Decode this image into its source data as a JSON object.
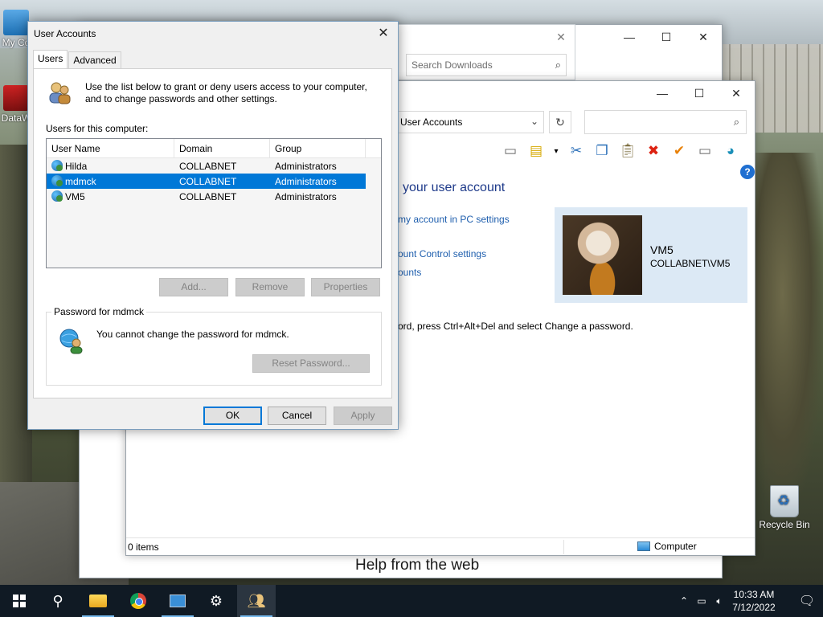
{
  "desktop": {
    "icons": [
      {
        "label": "My Co"
      },
      {
        "label": "DataW"
      }
    ],
    "recycle_bin": "Recycle Bin"
  },
  "help_window": {
    "help_from_web": "Help from the web"
  },
  "downloads_window": {
    "search_placeholder": "Search Downloads"
  },
  "control_panel": {
    "address": "User Accounts",
    "heading": "your user account",
    "links": [
      "my account in PC settings",
      "ount Control settings",
      "ounts"
    ],
    "user_name": "VM5",
    "user_domain": "COLLABNET\\VM5",
    "password_text": "ord, press Ctrl+Alt+Del and select Change a password.",
    "status_items": "0 items",
    "status_computer": "Computer"
  },
  "dialog": {
    "title": "User Accounts",
    "tabs": [
      "Users",
      "Advanced"
    ],
    "intro": "Use the list below to grant or deny users access to your computer, and to change passwords and other settings.",
    "users_label": "Users for this computer:",
    "columns": [
      "User Name",
      "Domain",
      "Group"
    ],
    "rows": [
      {
        "name": "Hilda",
        "domain": "COLLABNET",
        "group": "Administrators"
      },
      {
        "name": "mdmck",
        "domain": "COLLABNET",
        "group": "Administrators",
        "selected": true
      },
      {
        "name": "VM5",
        "domain": "COLLABNET",
        "group": "Administrators"
      }
    ],
    "buttons": {
      "add": "Add...",
      "remove": "Remove",
      "properties": "Properties"
    },
    "password_group_label": "Password for mdmck",
    "password_message": "You cannot change the password for mdmck.",
    "reset_password": "Reset Password...",
    "ok": "OK",
    "cancel": "Cancel",
    "apply": "Apply"
  },
  "taskbar": {
    "time": "10:33 AM",
    "date": "7/12/2022"
  }
}
